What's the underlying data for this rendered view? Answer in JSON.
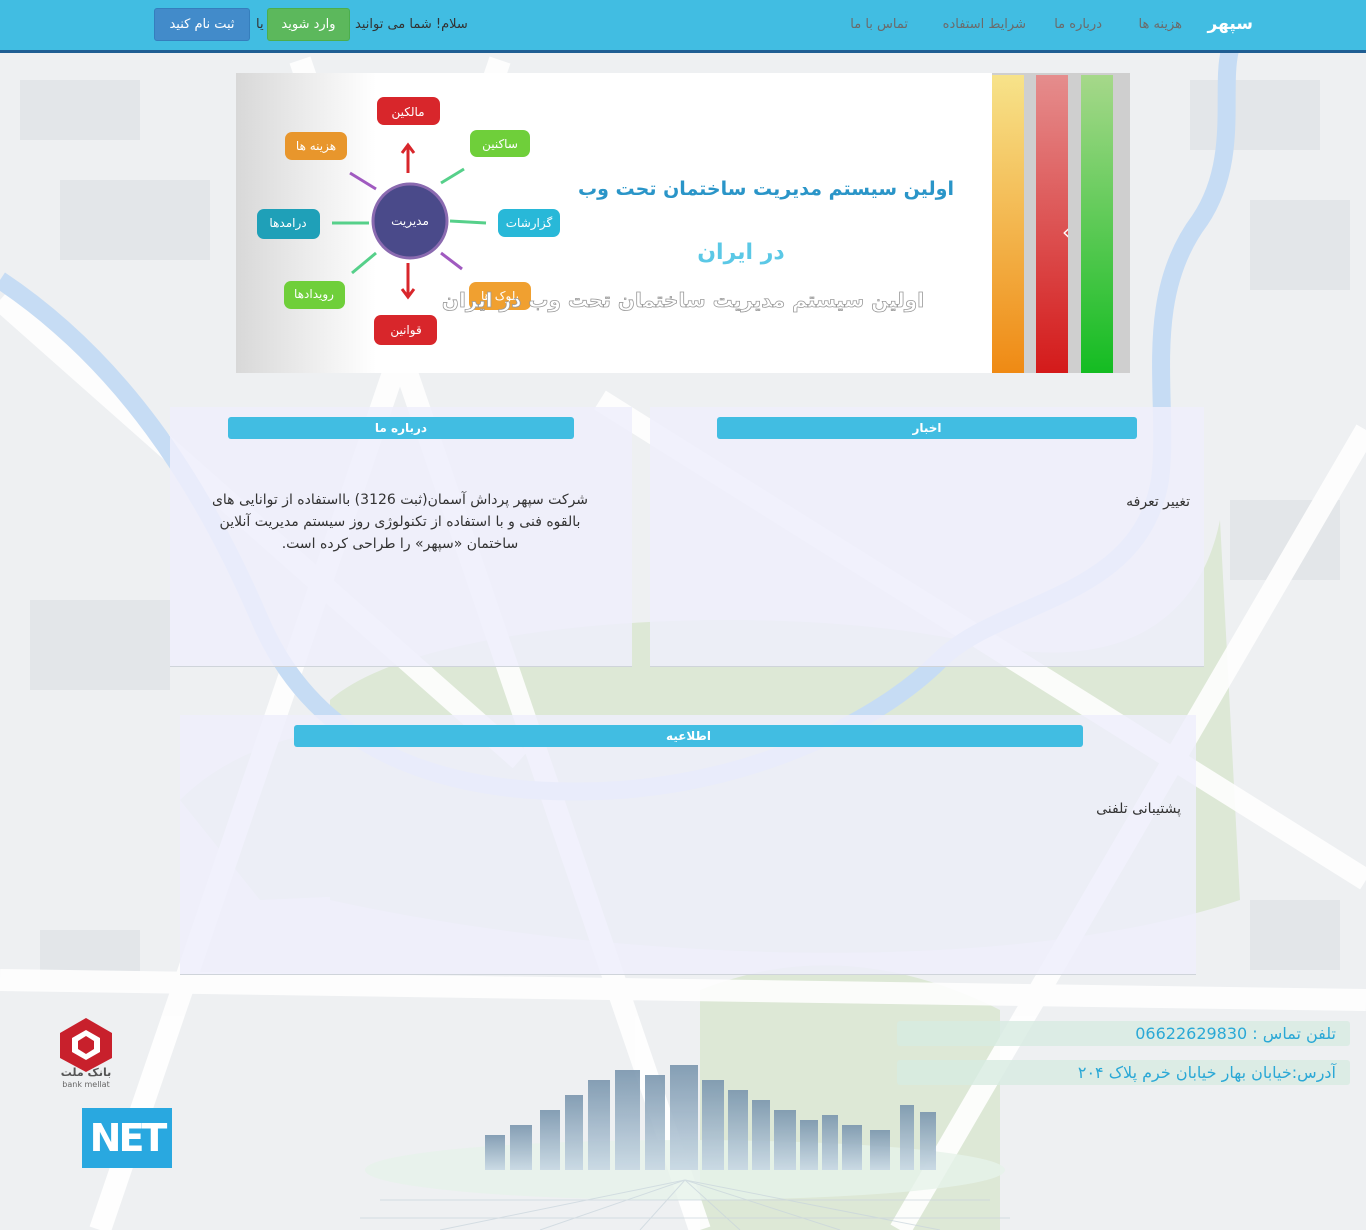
{
  "navbar": {
    "brand": "سپهر",
    "links": [
      "هزینه ها",
      "درباره ما",
      "شرایط استفاده",
      "تماس با ما"
    ],
    "greeting": "سلام! شما می توانید",
    "login": "وارد شوید",
    "or": "یا",
    "register": "ثبت نام کنید"
  },
  "banner": {
    "headline": "اولین سیستم مدیریت ساختمان تحت وب",
    "sub": "در ایران",
    "caption": "اولین سیستم مدیریت ساختمان تحت وب در ایران",
    "center_node": "مدیریت",
    "nodes": [
      "مالکین",
      "ساکنین",
      "گزارشات",
      "بلوک ها",
      "قوانین",
      "رویدادها",
      "درامدها",
      "هزینه ها"
    ],
    "next_arrow": "‹"
  },
  "news_panel": {
    "title": "اخبار",
    "item": "تغییر تعرفه"
  },
  "about_panel": {
    "title": "درباره ما",
    "lines": [
      "شرکت سپهر پرداش آسمان(ثبت 3126) بااستفاده از توانایی های",
      "بالقوه فنی و با استفاده از تکنولوژی روز سیستم مدیریت آنلاین",
      "ساختمان «سپهر» را طراحی کرده است."
    ]
  },
  "notice_panel": {
    "title": "اطلاعیه",
    "item": "پشتیبانی تلفنی"
  },
  "footer": {
    "phone": "تلفن تماس : 06622629830",
    "address": "آدرس:خیابان بهار خیابان خرم پلاک ۲۰۴",
    "bank_fa": "بانک ملت",
    "bank_en": "bank mellat",
    "net_logo": "NET"
  },
  "colors": {
    "navbar": "#41bde2",
    "nav_border": "#1f5e93",
    "login": "#5cb85c",
    "register": "#428bca"
  }
}
